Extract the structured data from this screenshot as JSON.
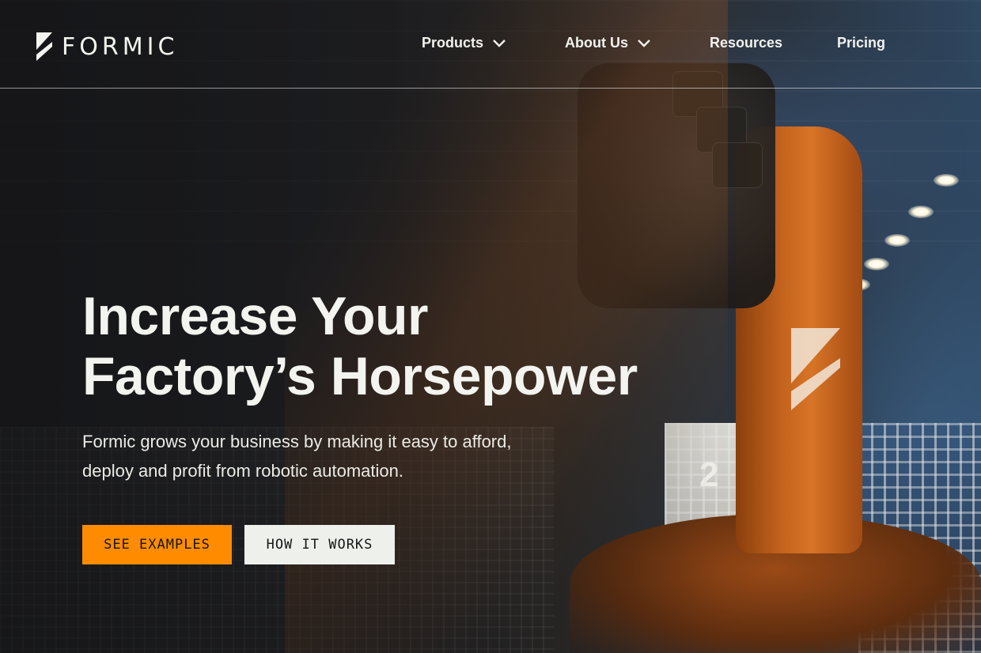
{
  "brand": {
    "name": "FORMIC",
    "accent_color": "#ff8c00"
  },
  "nav": {
    "items": [
      {
        "label": "Products",
        "has_dropdown": true,
        "icon": "chevron-down-icon"
      },
      {
        "label": "About Us",
        "has_dropdown": true,
        "icon": "chevron-down-icon"
      },
      {
        "label": "Resources",
        "has_dropdown": false
      },
      {
        "label": "Pricing",
        "has_dropdown": false
      }
    ]
  },
  "hero": {
    "title_line1": "Increase Your",
    "title_line2": "Factory’s Horsepower",
    "subtitle_line1": "Formic grows your business by making it easy to afford,",
    "subtitle_line2": "deploy and profit from robotic automation.",
    "primary_cta": "SEE EXAMPLES",
    "secondary_cta": "HOW IT WORKS"
  },
  "background": {
    "fence_number": "2"
  }
}
